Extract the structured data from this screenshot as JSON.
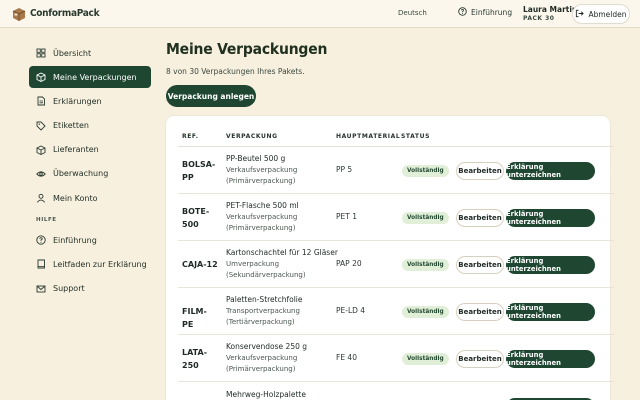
{
  "app": {
    "logo_text": "ConformaPack",
    "language": "Deutsch",
    "help_label": "Einführung",
    "user_name": "Laura Martin",
    "user_pack": "PACK 30",
    "logout_label": "Abmelden"
  },
  "sidebar": {
    "items": [
      {
        "label": "Übersicht",
        "icon": "grid-icon"
      },
      {
        "label": "Meine Verpackungen",
        "icon": "box-icon",
        "active": true
      },
      {
        "label": "Erklärungen",
        "icon": "document-icon"
      },
      {
        "label": "Etiketten",
        "icon": "tag-icon"
      },
      {
        "label": "Lieferanten",
        "icon": "cube-icon"
      },
      {
        "label": "Überwachung",
        "icon": "eye-icon"
      },
      {
        "label": "Mein Konto",
        "icon": "user-icon"
      }
    ],
    "section_label": "HILFE",
    "help_items": [
      {
        "label": "Einführung",
        "icon": "question-icon"
      },
      {
        "label": "Leitfaden zur Erklärung",
        "icon": "book-icon"
      },
      {
        "label": "Support",
        "icon": "mail-icon"
      }
    ]
  },
  "main": {
    "title": "Meine Verpackungen",
    "subtitle": "8 von 30 Verpackungen Ihres Pakets.",
    "create_label": "Verpackung anlegen",
    "table": {
      "headers": [
        "REF.",
        "VERPACKUNG",
        "HAUPTMATERIAL",
        "STATUS"
      ],
      "edit_label": "Bearbeiten",
      "sign_label": "Erklärung unterzeichnen",
      "rows": [
        {
          "ref": "BOLSA-PP",
          "name": "PP-Beutel 500 g",
          "type": "Verkaufsverpackung",
          "level": "(Primärverpackung)",
          "material": "PP 5",
          "status": "Vollständig"
        },
        {
          "ref": "BOTE-500",
          "name": "PET-Flasche 500 ml",
          "type": "Verkaufsverpackung",
          "level": "(Primärverpackung)",
          "material": "PET 1",
          "status": "Vollständig"
        },
        {
          "ref": "CAJA-12",
          "name": "Kartonschachtel für 12 Gläser",
          "type": "Umverpackung",
          "level": "(Sekundärverpackung)",
          "material": "PAP 20",
          "status": "Vollständig"
        },
        {
          "ref": "FILM-PE",
          "name": "Paletten-Stretchfolie",
          "type": "Transportverpackung",
          "level": "(Tertiärverpackung)",
          "material": "PE-LD 4",
          "status": "Vollständig"
        },
        {
          "ref": "LATA-250",
          "name": "Konservendose 250 g",
          "type": "Verkaufsverpackung",
          "level": "(Primärverpackung)",
          "material": "FE 40",
          "status": "Vollständig"
        },
        {
          "ref": "",
          "name": "Mehrweg-Holzpalette",
          "type": "",
          "level": "",
          "material": "",
          "status": ""
        }
      ]
    }
  }
}
